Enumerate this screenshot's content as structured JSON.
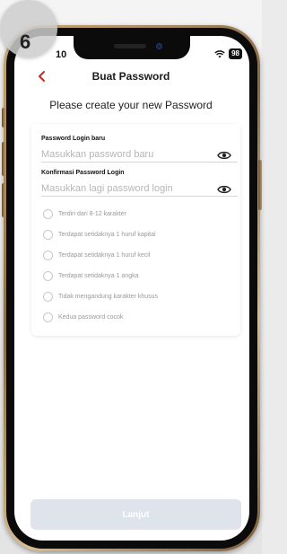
{
  "step": {
    "number": "6"
  },
  "status_bar": {
    "time": "10",
    "battery": "98"
  },
  "header": {
    "title": "Buat Password"
  },
  "subtitle": "Please create your new Password",
  "form": {
    "new_password": {
      "label": "Password Login baru",
      "placeholder": "Masukkan password baru"
    },
    "confirm_password": {
      "label": "Konfirmasi Password Login",
      "placeholder": "Masukkan lagi password login"
    }
  },
  "rules": [
    {
      "text": "Terdiri dari 8-12 karakter"
    },
    {
      "text": "Terdapat setidaknya 1 huruf kapital"
    },
    {
      "text": "Terdapat setidaknya 1 huruf kecil"
    },
    {
      "text": "Terdapat setidaknya 1 angka"
    },
    {
      "text": "Tidak mengandung karakter khusus"
    },
    {
      "text": "Kedua password cocok"
    }
  ],
  "cta": {
    "label": "Lanjut"
  },
  "colors": {
    "accent": "#c62828",
    "cta_disabled": "#dfe3ec"
  }
}
